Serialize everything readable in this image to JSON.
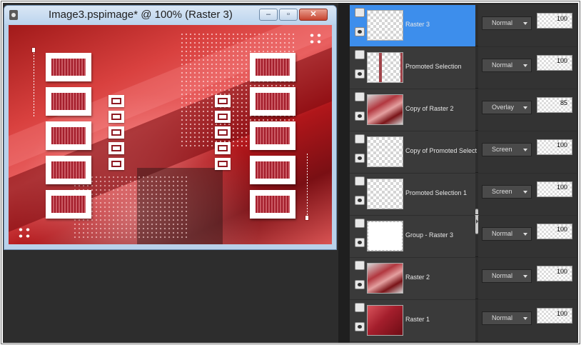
{
  "window": {
    "title": "Image3.pspimage* @ 100% (Raster 3)",
    "buttons": {
      "minimize": "–",
      "maximize": "▫",
      "close": "✕"
    }
  },
  "layers": [
    {
      "name": "Raster 3",
      "blend": "Normal",
      "opacity": "100",
      "selected": true,
      "thumb": "transparent"
    },
    {
      "name": "Promoted Selection",
      "blend": "Normal",
      "opacity": "100",
      "selected": false,
      "thumb": "frames"
    },
    {
      "name": "Copy of Raster 2",
      "blend": "Overlay",
      "opacity": "85",
      "selected": false,
      "thumb": "red-pattern"
    },
    {
      "name": "Copy of Promoted Selection",
      "blend": "Screen",
      "opacity": "100",
      "selected": false,
      "thumb": "transparent"
    },
    {
      "name": "Promoted Selection 1",
      "blend": "Screen",
      "opacity": "100",
      "selected": false,
      "thumb": "transparent"
    },
    {
      "name": "Group - Raster 3",
      "blend": "Normal",
      "opacity": "100",
      "selected": false,
      "thumb": "group"
    },
    {
      "name": "Raster 2",
      "blend": "Normal",
      "opacity": "100",
      "selected": false,
      "thumb": "red-pattern"
    },
    {
      "name": "Raster 1",
      "blend": "Normal",
      "opacity": "100",
      "selected": false,
      "thumb": "red-gradient"
    }
  ],
  "colors": {
    "selected_row": "#3d8eec",
    "panel_bg": "#2d2d2d",
    "accent_red": "#a41e2c"
  }
}
